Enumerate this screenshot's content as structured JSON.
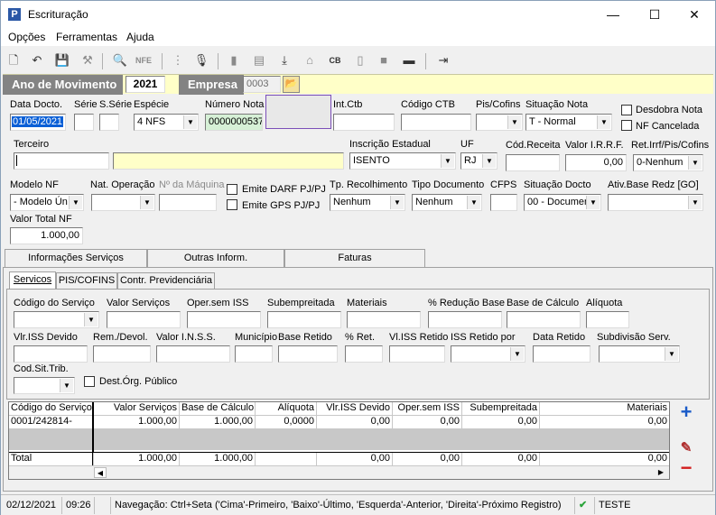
{
  "window": {
    "title": "Escrituração",
    "minimize": "—",
    "maximize": "☐",
    "close": "✕"
  },
  "menu": [
    "Opções",
    "Ferramentas",
    "Ajuda"
  ],
  "toolbar": {
    "icons": [
      "new-icon",
      "undo-icon",
      "save-icon",
      "tools-icon",
      "preview-icon",
      "nfe-icon",
      "tree-icon",
      "mic-icon",
      "panel-icon",
      "book-icon",
      "import-icon",
      "home-icon",
      "cb-icon",
      "doc-icon",
      "page-icon",
      "barcode-icon",
      "exit-icon"
    ],
    "nfe_label": "NFE"
  },
  "header": {
    "ano_label": "Ano de Movimento",
    "ano_value": "2021",
    "empresa_label": "Empresa",
    "empresa_value": "0003"
  },
  "nota": {
    "data_label": "Data Docto.",
    "data_value": "01/05/2021",
    "serie_label": "Série",
    "serie_value": "",
    "sserie_label": "S.Série",
    "sserie_value": "",
    "especie_label": "Espécie",
    "especie_value": "4 NFS",
    "numero_label": "Número Nota",
    "numero_value": "0000000537",
    "intctb_label": "Int.Ctb",
    "intctb_value": "",
    "codctb_label": "Código CTB",
    "codctb_value": "",
    "piscofins_label": "Pis/Cofins",
    "piscofins_value": "",
    "situacao_label": "Situação Nota",
    "situacao_value": "T - Normal",
    "desdobra_label": "Desdobra Nota",
    "cancelada_label": "NF Cancelada"
  },
  "terceiro": {
    "label": "Terceiro",
    "codigo": "",
    "nome": "",
    "ie_label": "Inscrição Estadual",
    "ie_value": "ISENTO",
    "uf_label": "UF",
    "uf_value": "RJ",
    "codreceita_label": "Cód.Receita",
    "codreceita_value": "",
    "irrf_label": "Valor I.R.R.F.",
    "irrf_value": "0,00",
    "retirrf_label": "Ret.Irrf/Pis/Cofins",
    "retirrf_value": "0-Nenhum"
  },
  "modelo": {
    "modelo_label": "Modelo NF",
    "modelo_value": "- Modelo Ún",
    "natop_label": "Nat. Operação",
    "natop_value": "",
    "maquina_label": "Nº da Máquina",
    "maquina_value": "",
    "darf_label": "Emite DARF PJ/PJ",
    "gps_label": "Emite GPS PJ/PJ",
    "tprec_label": "Tp. Recolhimento",
    "tprec_value": "Nenhum",
    "tpdoc_label": "Tipo Documento",
    "tpdoc_value": "Nenhum",
    "cfps_label": "CFPS",
    "cfps_value": "",
    "sitdoc_label": "Situação Docto",
    "sitdoc_value": "00 - Documer",
    "ativbase_label": "Ativ.Base Redz [GO]",
    "ativbase_value": "",
    "totalnf_label": "Valor Total NF",
    "totalnf_value": "1.000,00"
  },
  "tabs": [
    "Informações Serviços",
    "Outras Inform.",
    "Faturas"
  ],
  "subtabs": [
    "Servicos",
    "PIS/COFINS",
    "Contr. Previdenciária"
  ],
  "servico": {
    "codigo_label": "Código do Serviço",
    "valor_label": "Valor Serviços",
    "opersem_label": "Oper.sem ISS",
    "subempreitada_label": "Subempreitada",
    "materiais_label": "Materiais",
    "reducao_label": "% Redução Base",
    "base_label": "Base de Cálculo",
    "aliquota_label": "Alíquota",
    "vlrissdevido_label": "Vlr.ISS Devido",
    "remdevol_label": "Rem./Devol.",
    "valorinss_label": "Valor I.N.S.S.",
    "municipio_label": "Município",
    "baseretido_label": "Base Retido",
    "pctret_label": "% Ret.",
    "vlissretido_label": "Vl.ISS Retido",
    "issretidopor_label": "ISS Retido por",
    "dataretido_label": "Data Retido",
    "subdivisao_label": "Subdivisão Serv.",
    "codsittrib_label": "Cod.Sit.Trib.",
    "destorgao_label": "Dest.Órg. Público"
  },
  "grid": {
    "headers": [
      "Código do Serviço",
      "Valor Serviços",
      "Base de Cálculo",
      "Alíquota",
      "Vlr.ISS Devido",
      "Oper.sem ISS",
      "Subempreitada",
      "Materiais"
    ],
    "rows": [
      [
        "0001/242814-",
        "1.000,00",
        "1.000,00",
        "0,0000",
        "0,00",
        "0,00",
        "0,00",
        "0,00"
      ]
    ],
    "total": [
      "Total",
      "1.000,00",
      "1.000,00",
      "",
      "0,00",
      "0,00",
      "0,00",
      "0,00"
    ]
  },
  "status": {
    "date": "02/12/2021",
    "time": "09:26",
    "nav": "Navegação: Ctrl+Seta ('Cima'-Primeiro, 'Baixo'-Último, 'Esquerda'-Anterior, 'Direita'-Próximo Registro)",
    "user": "TESTE"
  },
  "colors": {
    "ano_bar": "#ffffc8",
    "label_bg": "#838383",
    "selected_date": "#0a5fd6",
    "add_blue": "#1a5bc8",
    "remove_red": "#d21e1e",
    "check_green": "#2aa43a",
    "focus_border": "#7b4fb8"
  }
}
